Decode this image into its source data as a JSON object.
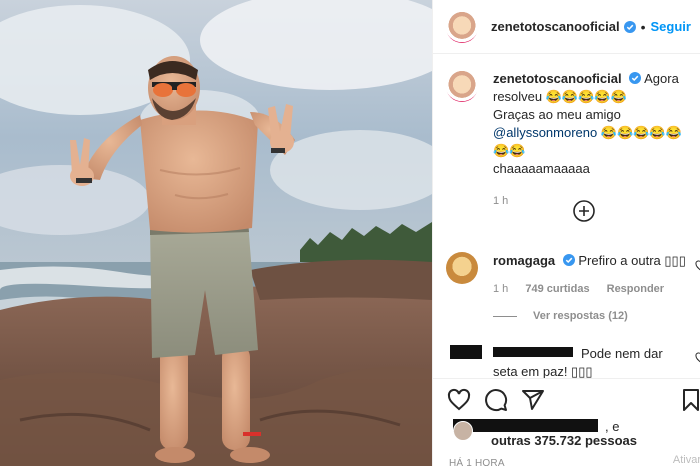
{
  "post": {
    "username": "zenetotoscanooficial",
    "follow_label": "Seguir",
    "separator": "•"
  },
  "caption": {
    "username": "zenetotoscanooficial",
    "line1": "Agora resolveu 😂😂😂😂😂",
    "line2": "Graças ao meu amigo",
    "mention": "@allyssonmoreno",
    "line2_emoji": "😂😂😂😂😂😂😂",
    "line3": "chaaaaamaaaaa",
    "time": "1 h"
  },
  "comments": [
    {
      "username": "romagaga",
      "text": "Prefiro a outra ",
      "emoji_placeholder": "▯▯▯",
      "time": "1 h",
      "likes": "749 curtidas",
      "reply_label": "Responder",
      "view_replies": "Ver respostas (12)"
    },
    {
      "text_line1": "Pode nem dar",
      "text_line2": "seta em paz! ▯▯▯"
    }
  ],
  "likes": {
    "suffix": ", e",
    "others": "outras 375.732 pessoas"
  },
  "timestamp": "HÁ 1 HORA",
  "watermark": "Ativar",
  "icons": [
    "verified-badge-icon",
    "plus-circle-icon",
    "heart-icon",
    "comment-icon",
    "share-icon",
    "bookmark-icon"
  ],
  "colors": {
    "accent": "#0095f6",
    "verified": "#3897f0",
    "text": "#262626",
    "muted": "#8e8e8e",
    "mention": "#00376b"
  }
}
